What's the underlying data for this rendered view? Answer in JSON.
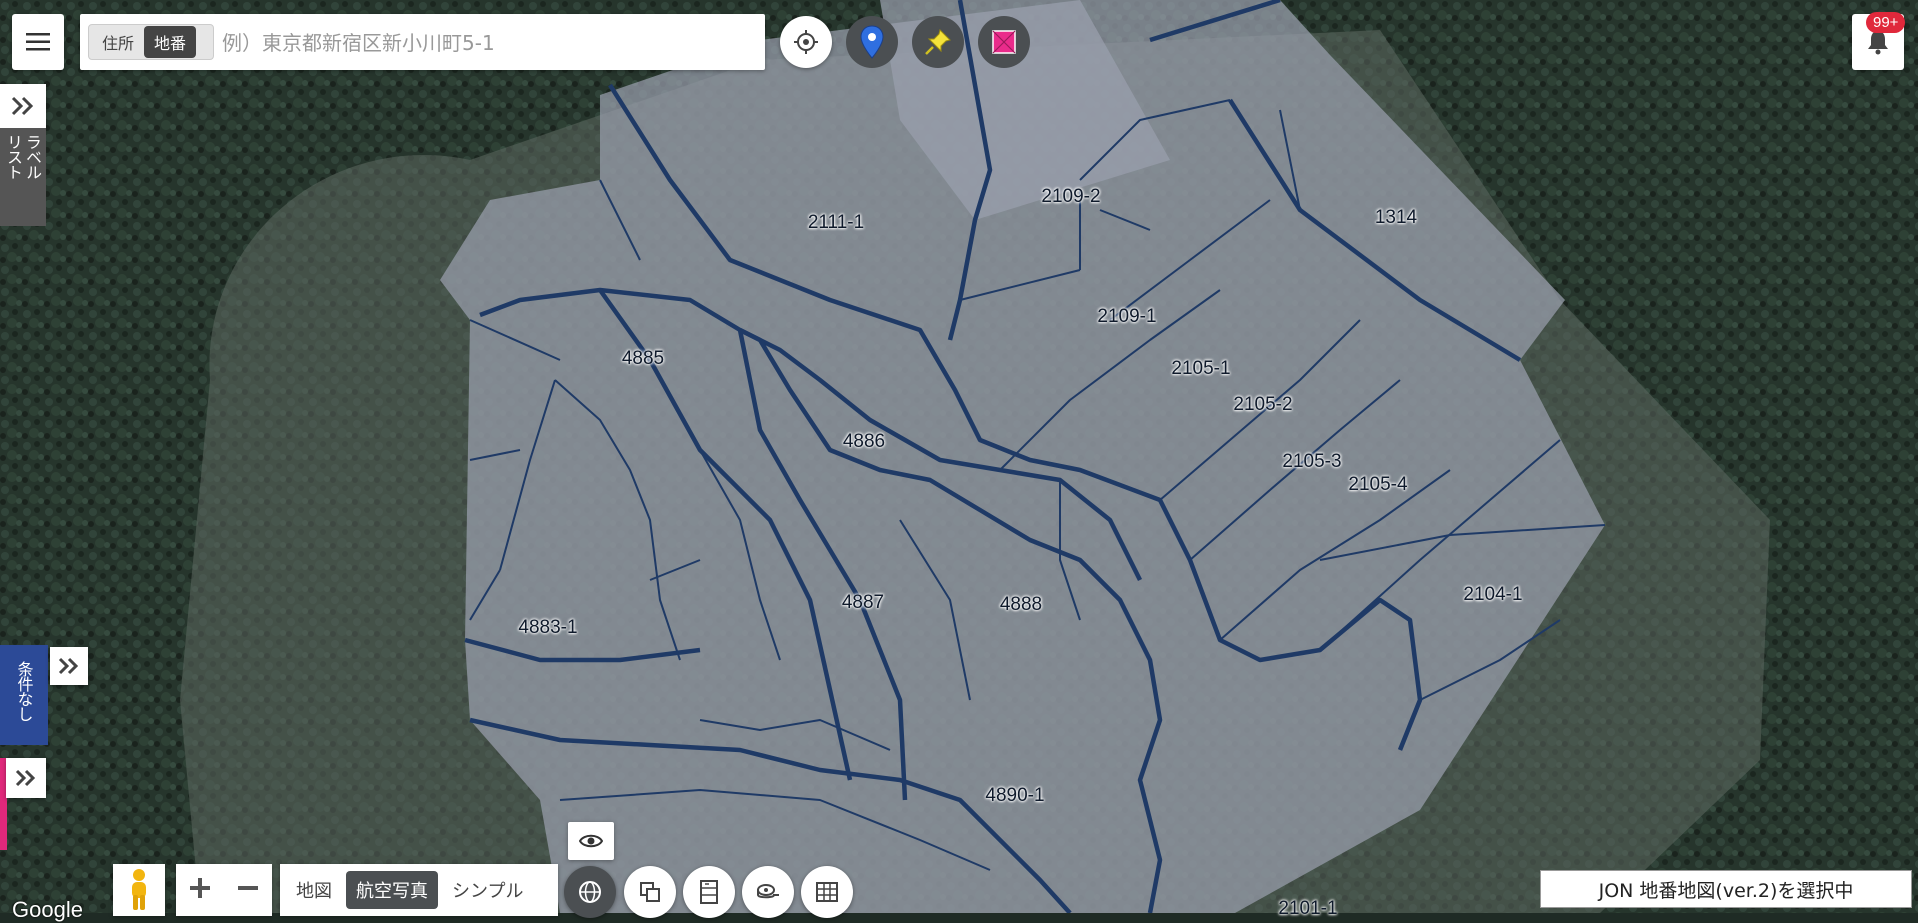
{
  "search": {
    "mode_address": "住所",
    "mode_lot": "地番",
    "placeholder": "例）東京都新宿区新小川町5-1"
  },
  "notifications": {
    "badge": "99+"
  },
  "side_panels": {
    "label_list_col1": "ラベル",
    "label_list_col2": "リスト",
    "condition": "条件なし"
  },
  "map_types": {
    "map": "地図",
    "aerial": "航空写真",
    "simple": "シンプル"
  },
  "map_select_label": "JON 地番地図(ver.2)を選択中",
  "google_logo": "Google",
  "parcels": [
    {
      "label": "2111-1"
    },
    {
      "label": "2109-2"
    },
    {
      "label": "1314"
    },
    {
      "label": "2109-1"
    },
    {
      "label": "4885"
    },
    {
      "label": "2105-1"
    },
    {
      "label": "2105-2"
    },
    {
      "label": "4886"
    },
    {
      "label": "2105-3"
    },
    {
      "label": "2105-4"
    },
    {
      "label": "4887"
    },
    {
      "label": "4888"
    },
    {
      "label": "2104-1"
    },
    {
      "label": "4883-1"
    },
    {
      "label": "4890-1"
    },
    {
      "label": "2101-1"
    }
  ],
  "colors": {
    "overlay": "#9aa0ad",
    "boundary": "#1f3a66",
    "accent_blue": "#2c4a97",
    "accent_pink": "#e0287b",
    "badge_red": "#e0283b"
  },
  "icons": [
    "menu-icon",
    "crosshair-icon",
    "map-marker-icon",
    "pushpin-icon",
    "polygon-icon",
    "bell-icon",
    "double-chevron-right-icon",
    "pegman-icon",
    "plus-icon",
    "minus-icon",
    "eye-icon",
    "globe-icon",
    "layers-icon",
    "list-icon",
    "measure-icon",
    "grid-icon"
  ]
}
